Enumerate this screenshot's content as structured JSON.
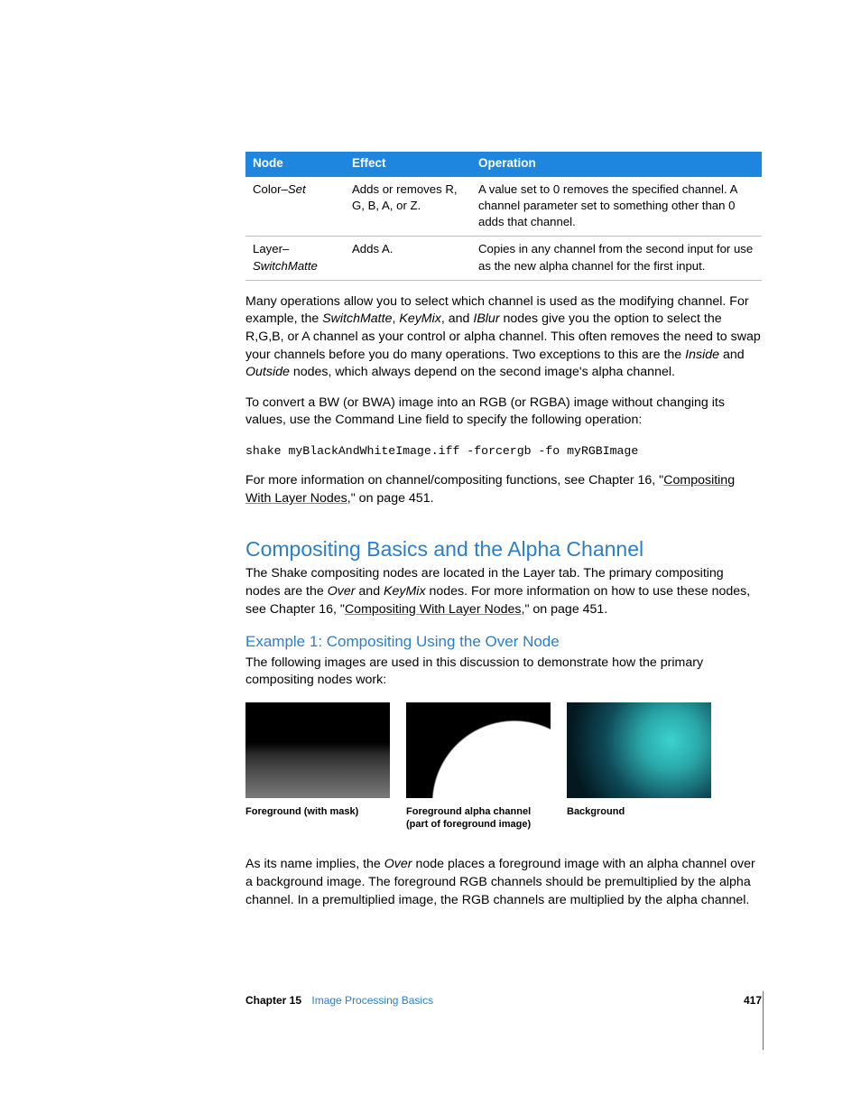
{
  "table": {
    "headers": {
      "node": "Node",
      "effect": "Effect",
      "operation": "Operation"
    },
    "rows": [
      {
        "node_pre": "Color–",
        "node_it": "Set",
        "effect": "Adds or removes R, G, B, A, or Z.",
        "operation": "A value set to 0 removes the specified channel. A channel parameter set to something other than 0 adds that channel."
      },
      {
        "node_pre": "Layer–",
        "node_it": "SwitchMatte",
        "effect": "Adds A.",
        "operation": "Copies in any channel from the second input for use as the new alpha channel for the first input."
      }
    ]
  },
  "para1": {
    "a": "Many operations allow you to select which channel is used as the modifying channel. For example, the ",
    "i1": "SwitchMatte",
    "b": ", ",
    "i2": "KeyMix",
    "c": ", and ",
    "i3": "IBlur",
    "d": " nodes give you the option to select the R,G,B, or A channel as your control or alpha channel. This often removes the need to swap your channels before you do many operations. Two exceptions to this are the ",
    "i4": "Inside",
    "e": " and ",
    "i5": "Outside",
    "f": " nodes, which always depend on the second image's alpha channel."
  },
  "para2": "To convert a BW (or BWA) image into an RGB (or RGBA) image without changing its values, use the Command Line field to specify the following operation:",
  "cmd": "shake myBlackAndWhiteImage.iff -forcergb -fo myRGBImage",
  "para3": {
    "a": "For more information on channel/compositing functions, see Chapter 16, \"",
    "link": "Compositing With Layer Nodes",
    "b": ",\" on page 451."
  },
  "h2": "Compositing Basics and the Alpha Channel",
  "para4": {
    "a": "The Shake compositing nodes are located in the Layer tab. The primary compositing nodes are the ",
    "i1": "Over",
    "b": " and ",
    "i2": "KeyMix",
    "c": " nodes. For more information on how to use these nodes, see Chapter 16, \"",
    "link": "Compositing With Layer Nodes",
    "d": ",\" on page 451."
  },
  "h3": "Example 1:  Compositing Using the Over Node",
  "para5": "The following images are used in this discussion to demonstrate how the primary compositing nodes work:",
  "captions": {
    "fg": "Foreground (with mask)",
    "alpha": "Foreground alpha channel (part of foreground image)",
    "bg": "Background"
  },
  "para6": {
    "a": "As its name implies, the ",
    "i1": "Over",
    "b": " node places a foreground image with an alpha channel over a background image. The foreground RGB channels should be premultiplied by the alpha channel. In a premultiplied image, the RGB channels are multiplied by the alpha channel."
  },
  "footer": {
    "chapter_strong": "Chapter 15",
    "chapter_title": "Image Processing Basics",
    "page": "417"
  }
}
